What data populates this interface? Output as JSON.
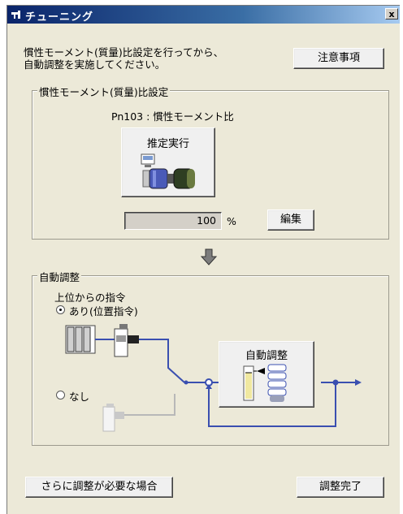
{
  "window": {
    "title": "チューニング",
    "close_glyph": "x"
  },
  "instruction": {
    "line1": "慣性モーメント(質量)比設定を行ってから、",
    "line2": "自動調整を実施してください。"
  },
  "notes_button": "注意事項",
  "inertia_group": {
    "legend": "慣性モーメント(質量)比設定",
    "param_label": "Pn103 : 慣性モーメント比",
    "estimate_button": "推定実行",
    "ratio_value": "100",
    "unit": "%",
    "edit_button": "編集"
  },
  "auto_group": {
    "legend": "自動調整",
    "command_label": "上位からの指令",
    "option_with": "あり(位置指令)",
    "option_without": "なし",
    "selected": "option_with",
    "auto_tuning_button": "自動調整"
  },
  "footer": {
    "more_button": "さらに調整が必要な場合",
    "complete_button": "調整完了"
  },
  "colors": {
    "signal_line": "#3a4fb0",
    "disabled_line": "#b8b8b8",
    "title_bar": "#0a246a"
  }
}
